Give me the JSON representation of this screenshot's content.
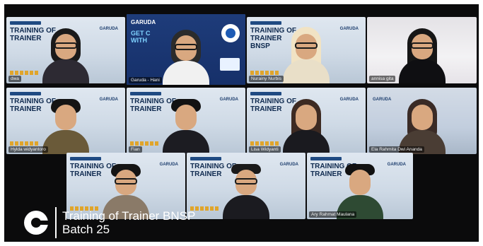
{
  "meeting": {
    "participants": [
      {
        "name": "dwa",
        "background": "slide",
        "hair": "#1a1a1a",
        "body": "#2d2a33"
      },
      {
        "name": "Garuda - Hani",
        "background": "garuda",
        "hair": "#2b2b2b",
        "body": "#f1f1f1",
        "active": true
      },
      {
        "name": "Nurainy Nurbis",
        "background": "slide",
        "hair": "#f1e3c4",
        "body": "#e9dfc8"
      },
      {
        "name": "annisa gita",
        "background": "room",
        "hair": "#161616",
        "body": "#0f0f12"
      },
      {
        "name": "Hylda widyantoro",
        "background": "slide",
        "hair": "#141414",
        "body": "#6a5a39"
      },
      {
        "name": "Fian",
        "background": "slide",
        "hair": "#121212",
        "body": "#1c1c22"
      },
      {
        "name": "Lisa Widyanti",
        "background": "slide",
        "hair": "#3d2a22",
        "body": "#1a1a1f"
      },
      {
        "name": "Ela Rahmita Dwi Ananda",
        "background": "slide-right",
        "hair": "#3a2b26",
        "body": "#4a3d34"
      },
      {
        "name": "",
        "background": "slide",
        "hair": "#141414",
        "body": "#8a7a68"
      },
      {
        "name": "",
        "background": "slide",
        "hair": "#1a1a1a",
        "body": "#1b1b20"
      },
      {
        "name": "Ary Rahmat Maulana",
        "background": "slide",
        "hair": "#111111",
        "body": "#2e4a33"
      }
    ],
    "slide": {
      "tag": "",
      "heading_line1": "TRAINING OF",
      "heading_line2": "TRAINER",
      "heading_line3": "BNSP",
      "brand": "GARUDA",
      "subtitle": "PT. Garuda Sytrosis Indonesia"
    },
    "garuda_slide": {
      "brand": "GARUDA",
      "heading_line1": "GET C",
      "heading_line2": "WITH"
    }
  },
  "banner": {
    "title_line1": "Training of Trainer  BNSP",
    "title_line2": "Batch 25",
    "logo_icon": "garuda-logo-icon"
  },
  "colors": {
    "frame_bg": "#0b0b0c",
    "active_outline": "#3ab0ff",
    "banner_text": "#ffffff"
  }
}
